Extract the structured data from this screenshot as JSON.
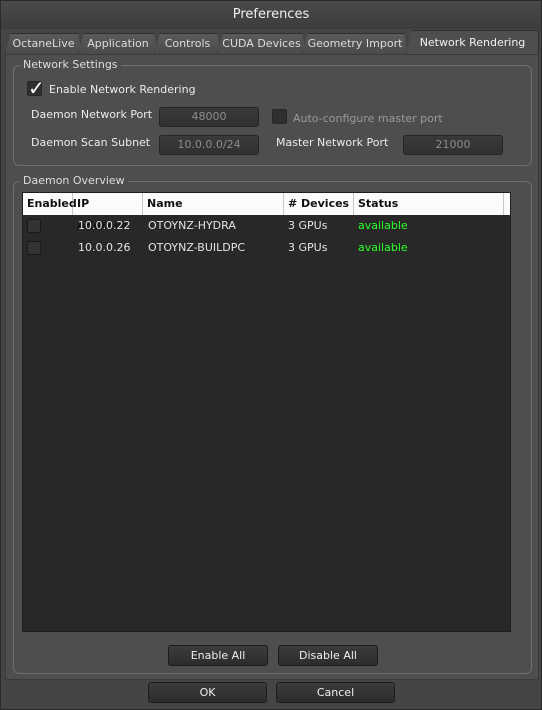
{
  "window": {
    "title": "Preferences"
  },
  "tabs": [
    {
      "label": "OctaneLive"
    },
    {
      "label": "Application"
    },
    {
      "label": "Controls"
    },
    {
      "label": "CUDA Devices"
    },
    {
      "label": "Geometry Import"
    },
    {
      "label": "Network Rendering",
      "active": true
    }
  ],
  "network_settings": {
    "title": "Network Settings",
    "enable_label": "Enable Network Rendering",
    "enable_checked": true,
    "daemon_port_label": "Daemon Network Port",
    "daemon_port_value": "48000",
    "auto_config_label": "Auto-configure master port",
    "auto_config_checked": false,
    "scan_subnet_label": "Daemon Scan Subnet",
    "scan_subnet_value": "10.0.0.0/24",
    "master_port_label": "Master Network Port",
    "master_port_value": "21000"
  },
  "daemon_overview": {
    "title": "Daemon Overview",
    "columns": [
      "Enabled",
      "IP Address",
      "Name",
      "# Devices",
      "Status"
    ],
    "rows": [
      {
        "enabled": false,
        "ip": "10.0.0.22",
        "name": "OTOYNZ-HYDRA",
        "devices": "3 GPUs",
        "status": "available"
      },
      {
        "enabled": false,
        "ip": "10.0.0.26",
        "name": "OTOYNZ-BUILDPC",
        "devices": "3 GPUs",
        "status": "available"
      }
    ],
    "enable_all_label": "Enable All",
    "disable_all_label": "Disable All"
  },
  "footer": {
    "ok_label": "OK",
    "cancel_label": "Cancel"
  },
  "colors": {
    "status_available": "#2aff2a",
    "background": "#4e4e4e"
  }
}
